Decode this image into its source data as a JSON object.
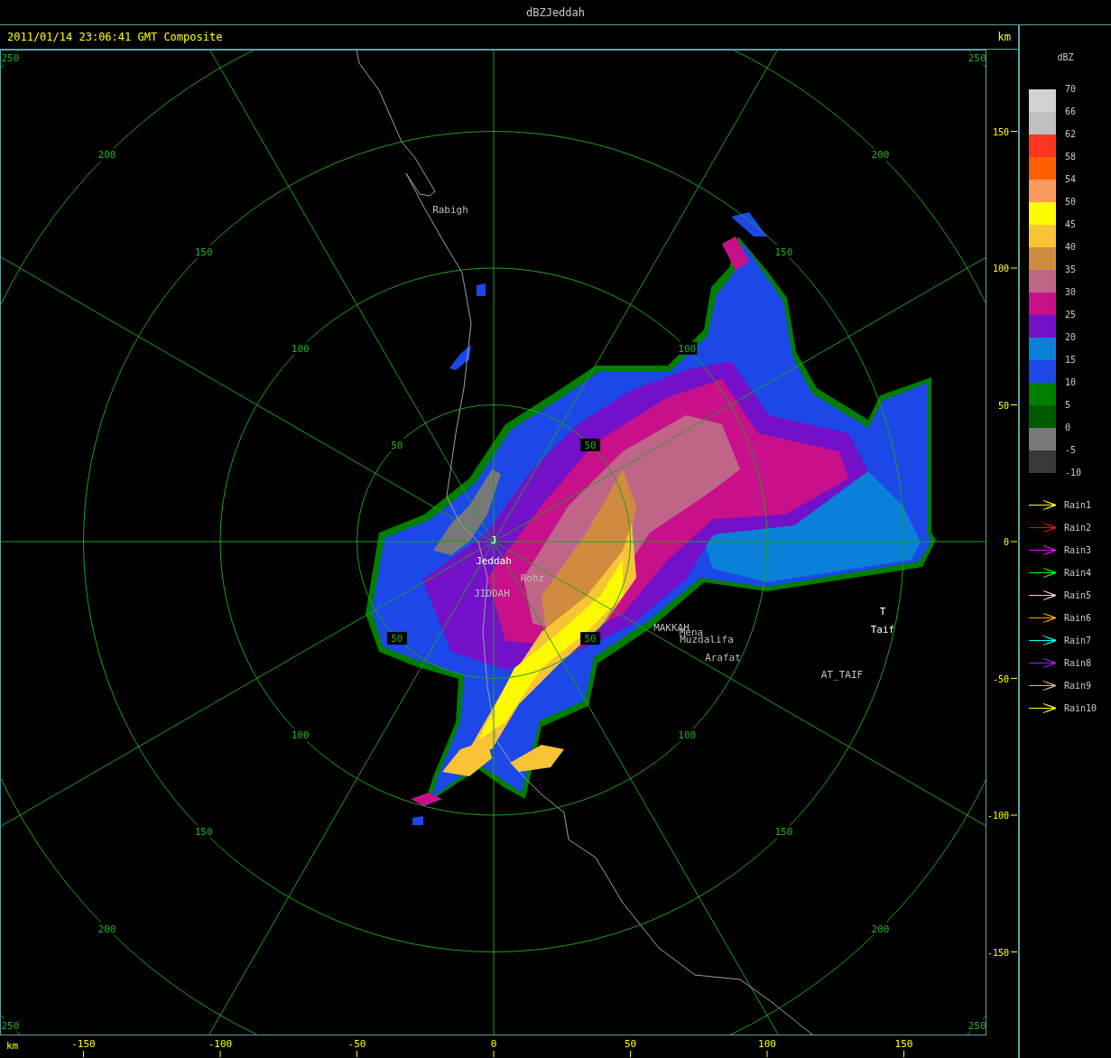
{
  "window": {
    "title": "dBZJeddah"
  },
  "header": {
    "timestamp": "2011/01/14 23:06:41 GMT Composite",
    "unit": "km"
  },
  "range_rings": [
    {
      "labels": [
        "50",
        "50",
        "50",
        "50"
      ]
    },
    {
      "labels": [
        "100",
        "100",
        "100",
        "100"
      ]
    },
    {
      "labels": [
        "150",
        "150",
        "150",
        "150"
      ]
    },
    {
      "labels": [
        "200",
        "200",
        "200",
        "200"
      ]
    },
    {
      "labels": [
        "250",
        "250",
        "250",
        "250"
      ]
    }
  ],
  "places": [
    {
      "text": "Rabigh",
      "kind": "town"
    },
    {
      "text": "J",
      "kind": "station"
    },
    {
      "text": "Jeddah",
      "kind": "station"
    },
    {
      "text": "Rohz",
      "kind": "town"
    },
    {
      "text": "JIDDAH",
      "kind": "town"
    },
    {
      "text": "MAKKAH",
      "kind": "town"
    },
    {
      "text": "Mena",
      "kind": "town"
    },
    {
      "text": "Muzdalifa",
      "kind": "town"
    },
    {
      "text": "Arafat",
      "kind": "town"
    },
    {
      "text": "T",
      "kind": "station"
    },
    {
      "text": "Taif",
      "kind": "station"
    },
    {
      "text": "AT_TAIF",
      "kind": "town"
    }
  ],
  "y_axis": {
    "ticks": [
      "150",
      "100",
      "50",
      "0",
      "-50",
      "-100",
      "-150"
    ]
  },
  "x_axis": {
    "unit": "km",
    "ticks": [
      "-150",
      "-100",
      "-50",
      "0",
      "50",
      "100",
      "150"
    ]
  },
  "legend": {
    "title": "dBZ",
    "labels": [
      "70",
      "66",
      "62",
      "58",
      "54",
      "50",
      "45",
      "40",
      "35",
      "30",
      "25",
      "20",
      "15",
      "10",
      "5",
      "0",
      "-5",
      "-10"
    ],
    "bands": [
      {
        "color": "#d3d3d3"
      },
      {
        "color": "#c0c0c0"
      },
      {
        "color": "#fc3422"
      },
      {
        "color": "#fd5f00"
      },
      {
        "color": "#fc9a5e"
      },
      {
        "color": "#fefb00"
      },
      {
        "color": "#f8c436"
      },
      {
        "color": "#d08b3e"
      },
      {
        "color": "#bf6688"
      },
      {
        "color": "#c8108a"
      },
      {
        "color": "#7410c8"
      },
      {
        "color": "#0a80d8"
      },
      {
        "color": "#1c48e8"
      },
      {
        "color": "#007e00"
      },
      {
        "color": "#005a00"
      },
      {
        "color": "#787878"
      },
      {
        "color": "#383838"
      }
    ]
  },
  "rain_arrows": [
    {
      "label": "Rain1",
      "color": "#ffff00"
    },
    {
      "label": "Rain2",
      "color": "#ff0000"
    },
    {
      "label": "Rain3",
      "color": "#ff00ff"
    },
    {
      "label": "Rain4",
      "color": "#00ff00"
    },
    {
      "label": "Rain5",
      "color": "#ffc0cb"
    },
    {
      "label": "Rain6",
      "color": "#ffa500"
    },
    {
      "label": "Rain7",
      "color": "#00ffff"
    },
    {
      "label": "Rain8",
      "color": "#a020f0"
    },
    {
      "label": "Rain9",
      "color": "#d2b48c"
    },
    {
      "label": "Rain10",
      "color": "#ffff00"
    }
  ]
}
